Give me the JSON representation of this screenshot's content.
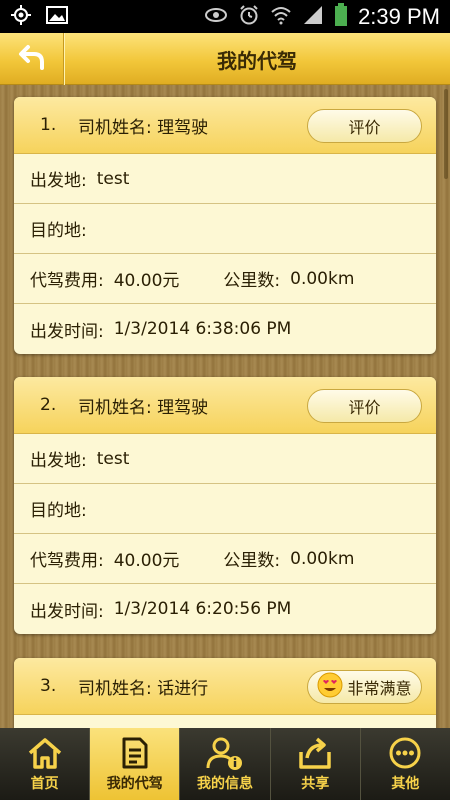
{
  "status_bar": {
    "time": "2:39 PM",
    "left_icons": [
      "gps-icon",
      "image-icon"
    ],
    "right_icons": [
      "eye-icon",
      "alarm-icon",
      "wifi-icon",
      "signal-icon",
      "battery-icon"
    ]
  },
  "header": {
    "title": "我的代驾",
    "back_icon": "back-arrow-icon"
  },
  "orders": [
    {
      "index": "1.",
      "driver_label": "司机姓名: 理驾驶",
      "rate_label": "评价",
      "origin_label": "出发地:",
      "origin_value": "test",
      "dest_label": "目的地:",
      "fee_label": "代驾费用:",
      "fee_value": "40.00元",
      "km_label": "公里数:",
      "km_value": "0.00km",
      "time_label": "出发时间:",
      "time_value": "1/3/2014 6:38:06 PM"
    },
    {
      "index": "2.",
      "driver_label": "司机姓名: 理驾驶",
      "rate_label": "评价",
      "origin_label": "出发地:",
      "origin_value": "test",
      "dest_label": "目的地:",
      "fee_label": "代驾费用:",
      "fee_value": "40.00元",
      "km_label": "公里数:",
      "km_value": "0.00km",
      "time_label": "出发时间:",
      "time_value": "1/3/2014 6:20:56 PM"
    },
    {
      "index": "3.",
      "driver_label": "司机姓名: 话进行",
      "rate_label": "非常满意",
      "rate_icon": "heart-eyes-emoji-icon"
    }
  ],
  "tabs": [
    {
      "label": "首页",
      "icon": "home-icon",
      "active": false
    },
    {
      "label": "我的代驾",
      "icon": "document-icon",
      "active": true
    },
    {
      "label": "我的信息",
      "icon": "user-info-icon",
      "active": false
    },
    {
      "label": "共享",
      "icon": "share-icon",
      "active": false
    },
    {
      "label": "其他",
      "icon": "more-icon",
      "active": false
    }
  ],
  "colors": {
    "accent": "#f2c73a",
    "tab_bar": "#2b2a22",
    "card_bg": "#fdf8d4",
    "text": "#2b2004"
  }
}
